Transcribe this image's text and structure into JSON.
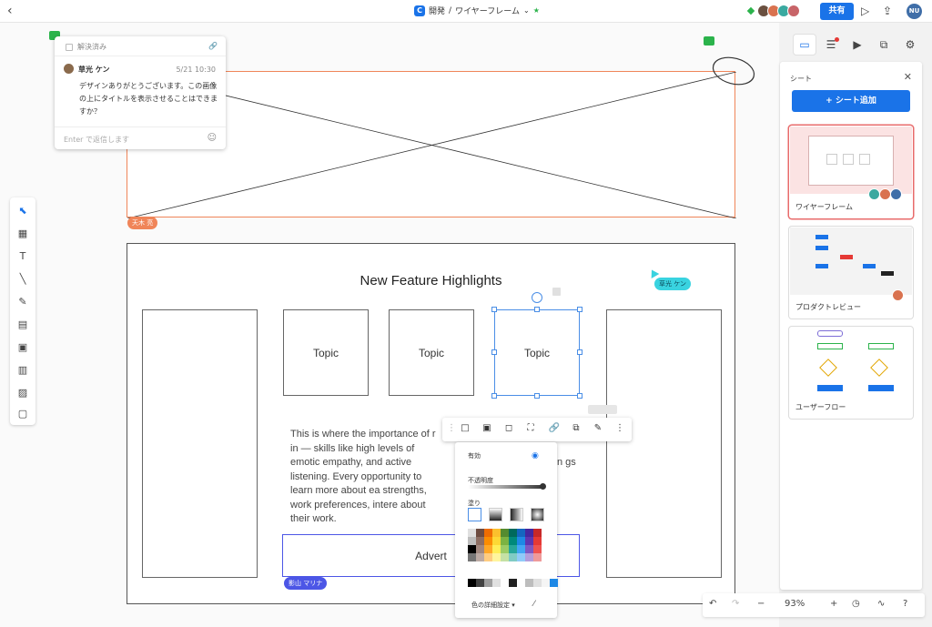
{
  "topbar": {
    "app_icon": "C",
    "breadcrumb_project": "開発",
    "breadcrumb_sep": "/",
    "breadcrumb_page": "ワイヤーフレーム",
    "share_label": "共有",
    "user_initials": "NU"
  },
  "comment": {
    "resolved_label": "解決済み",
    "author": "草光 ケン",
    "time": "5/21 10:30",
    "message": "デザインありがとうございます。この画像の上にタイトルを表示させることはできますか？",
    "reply_placeholder": "Enter で返信します"
  },
  "canvas": {
    "tags": {
      "amaki": "天木 亮",
      "kusamitsu": "草光 ケン",
      "kageyama": "影山 マリナ"
    },
    "wire_title": "New Feature Highlights",
    "topics": [
      "Topic",
      "Topic",
      "Topic"
    ],
    "body_text": "This is where the importance of r in — skills like high levels of emotic empathy, and active listening. Every opportunity to learn more about ea strengths, work preferences, intere about their work.",
    "body_text_right": "n gs",
    "advert": "Advert"
  },
  "fill_panel": {
    "enabled_label": "有効",
    "opacity_label": "不透明度",
    "fill_label": "塗り",
    "detail_label": "色の詳細設定",
    "swatch_colors": [
      "#e0e0e0",
      "#6d4c41",
      "#ef6c00",
      "#fbc02d",
      "#558b2f",
      "#00695c",
      "#1565c0",
      "#4527a0",
      "#c62828",
      "#bdbdbd",
      "#8d6e63",
      "#fb8c00",
      "#fdd835",
      "#7cb342",
      "#00897b",
      "#1e88e5",
      "#5e35b1",
      "#e53935",
      "#000000",
      "#a1887f",
      "#ffa726",
      "#ffee58",
      "#9ccc65",
      "#26a69a",
      "#42a5f5",
      "#7e57c2",
      "#ef5350",
      "#757575",
      "#bcaaa4",
      "#ffcc80",
      "#fff59d",
      "#c5e1a5",
      "#80cbc4",
      "#90caf9",
      "#b39ddb",
      "#ef9a9a"
    ],
    "grey_colors": [
      "#000000",
      "#424242",
      "#9e9e9e",
      "#e0e0e0",
      "#ffffff",
      "#212121",
      "#ffffff",
      "#bdbdbd",
      "#e0e0e0",
      "#f5f5f5",
      "#1e88e5"
    ]
  },
  "sheets": {
    "title": "シート",
    "add_label": "+ シート追加",
    "items": [
      {
        "label": "ワイヤーフレーム"
      },
      {
        "label": "プロダクトレビュー"
      },
      {
        "label": "ユーザーフロー"
      }
    ]
  },
  "zoom": {
    "level": "93%",
    "minus": "−",
    "plus": "+"
  },
  "colors": {
    "accent": "#1a73e8",
    "hero_border": "#f08559",
    "selection": "#4a8ee6",
    "advert_border": "#4c56e6"
  }
}
